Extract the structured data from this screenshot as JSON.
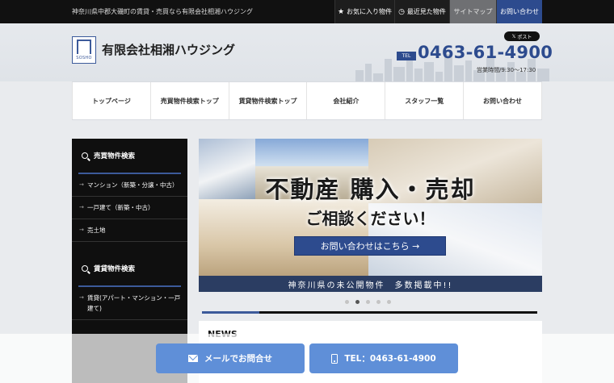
{
  "topbar": {
    "tagline": "神奈川県中郡大磯町の賃貸・売買なら有限会社相湘ハウジング",
    "links": {
      "favorites": "お気に入り物件",
      "recent": "最近見た物件",
      "sitemap": "サイトマップ",
      "contact": "お問い合わせ"
    },
    "icons": {
      "favorites": "star-icon",
      "recent": "clock-icon"
    }
  },
  "header": {
    "logo_text": "SOSHO",
    "company": "有限会社相湘ハウジング",
    "x_post": "ポスト",
    "tel_label": "TEL",
    "tel": "0463-61-4900",
    "hours": "営業時間/9:30～17:30"
  },
  "nav": [
    "トップページ",
    "売買物件検索トップ",
    "賃貸物件検索トップ",
    "会社紹介",
    "スタッフ一覧",
    "お問い合わせ"
  ],
  "sidebar": {
    "sale": {
      "title": "売買物件検索",
      "items": [
        "マンション（新築・分譲・中古）",
        "一戸建て（新築・中古）",
        "売土地"
      ]
    },
    "rent": {
      "title": "賃貸物件検索",
      "items": [
        "賃貸(アパート・マンション・一戸建て)"
      ]
    }
  },
  "banner": {
    "title": "不動産 購入・売却",
    "subtitle": "ご相談ください！",
    "cta": "お問い合わせはこちら →",
    "strip": "神奈川県の未公開物件　多数掲載中!!"
  },
  "slider": {
    "count": 5,
    "active_index": 1,
    "progress": 0.17
  },
  "news": {
    "title": "NEWS"
  },
  "footer_buttons": {
    "mail": "メールでお問合せ",
    "tel": "TEL：0463-61-4900"
  },
  "colors": {
    "brand": "#2d4b8e",
    "accent": "#5f8fd8",
    "sidebar": "#0f0f0f"
  }
}
